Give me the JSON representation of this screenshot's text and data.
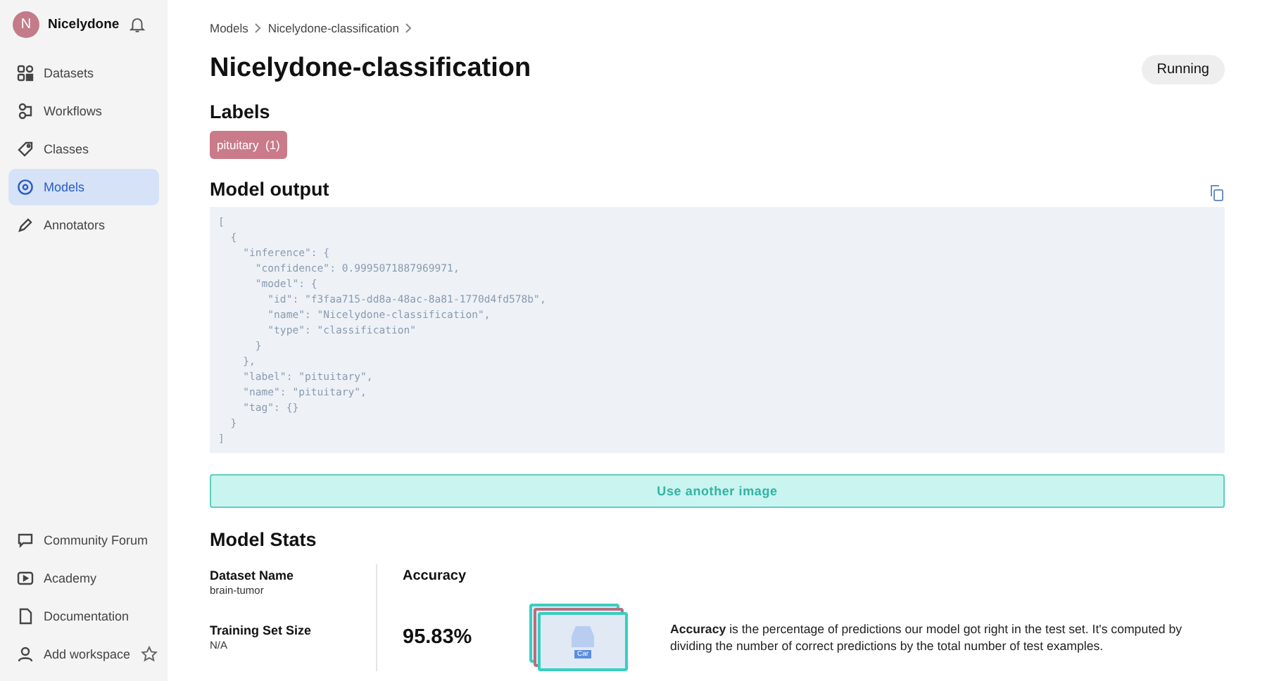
{
  "sidebar": {
    "workspace": {
      "initial": "N",
      "name": "Nicelydone"
    },
    "items": [
      {
        "label": "Datasets",
        "kind": "grid",
        "selected": false
      },
      {
        "label": "Workflows",
        "kind": "flow",
        "selected": false
      },
      {
        "label": "Classes",
        "kind": "tag",
        "selected": false
      },
      {
        "label": "Models",
        "kind": "model",
        "selected": true
      },
      {
        "label": "Annotators",
        "kind": "pen",
        "selected": false
      }
    ],
    "footer_items": [
      {
        "label": "Community Forum",
        "kind": "chat"
      },
      {
        "label": "Academy",
        "kind": "play"
      },
      {
        "label": "Documentation",
        "kind": "doc"
      },
      {
        "label": "Add workspace",
        "kind": "user",
        "starred": false
      }
    ]
  },
  "breadcrumbs": [
    "Models",
    "Nicelydone-classification"
  ],
  "title": "Nicelydone-classification",
  "status": "Running",
  "labels": {
    "heading": "Labels",
    "tags": [
      {
        "name": "pituitary",
        "count": "(1)",
        "color": "#c97b8a"
      }
    ]
  },
  "model_output": {
    "heading": "Model output",
    "lines": [
      "[",
      "  {",
      "    \"inference\": {",
      "      \"confidence\": 0.9995071887969971,",
      "      \"model\": {",
      "        \"id\": \"f3faa715-dd8a-48ac-8a81-1770d4fd578b\",",
      "        \"name\": \"Nicelydone-classification\",",
      "        \"type\": \"classification\"",
      "      }",
      "    },",
      "    \"label\": \"pituitary\",",
      "    \"name\": \"pituitary\",",
      "    \"tag\": {}",
      "  }",
      "]"
    ]
  },
  "use_another_image": "Use another image",
  "stats": {
    "heading": "Model Stats",
    "fields": [
      {
        "label": "Dataset Name",
        "value": "brain-tumor"
      },
      {
        "label": "Training Set Size",
        "value": "N/A"
      }
    ],
    "metric": {
      "title": "Accuracy",
      "value": "95.83%",
      "illustration_label": "Car",
      "description": "**Accuracy** is the percentage of predictions our model got right in the test set. It's computed by dividing the number of correct predictions by the total number of test examples."
    }
  }
}
